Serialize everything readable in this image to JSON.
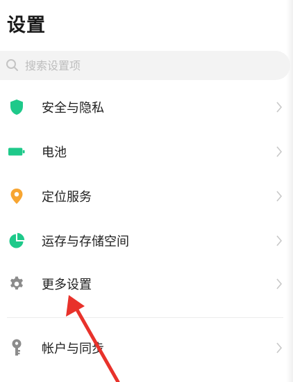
{
  "header": {
    "title": "设置"
  },
  "search": {
    "placeholder": "搜索设置项",
    "icon": "search-icon"
  },
  "items": [
    {
      "label": "安全与隐私",
      "icon": "shield-icon",
      "color": "#1ec98a"
    },
    {
      "label": "电池",
      "icon": "battery-icon",
      "color": "#1ec98a"
    },
    {
      "label": "定位服务",
      "icon": "location-pin-icon",
      "color": "#f7a531"
    },
    {
      "label": "运存与存储空间",
      "icon": "pie-chart-icon",
      "color": "#1ec98a"
    },
    {
      "label": "更多设置",
      "icon": "gear-icon",
      "color": "#8c8c8c"
    },
    {
      "label": "帐户与同步",
      "icon": "key-icon",
      "color": "#8c8c8c"
    }
  ],
  "annotation": {
    "color": "#e8322b"
  }
}
